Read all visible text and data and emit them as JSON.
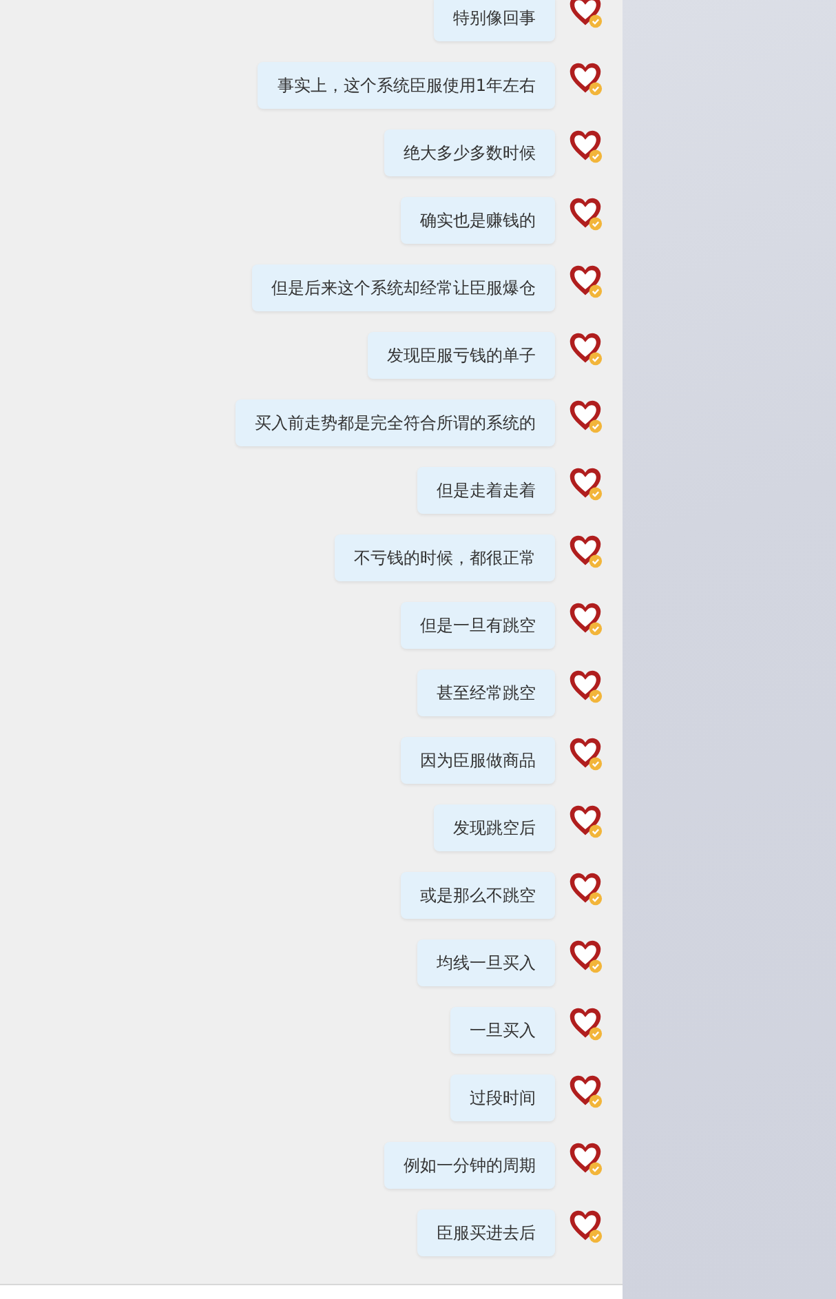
{
  "messages": [
    {
      "text": "特别像回事"
    },
    {
      "text": "事实上，这个系统臣服使用1年左右"
    },
    {
      "text": "绝大多少多数时候"
    },
    {
      "text": "确实也是赚钱的"
    },
    {
      "text": "但是后来这个系统却经常让臣服爆仓"
    },
    {
      "text": "发现臣服亏钱的单子"
    },
    {
      "text": "买入前走势都是完全符合所谓的系统的"
    },
    {
      "text": "但是走着走着"
    },
    {
      "text": "不亏钱的时候，都很正常"
    },
    {
      "text": "但是一旦有跳空"
    },
    {
      "text": "甚至经常跳空"
    },
    {
      "text": "因为臣服做商品"
    },
    {
      "text": "发现跳空后"
    },
    {
      "text": "或是那么不跳空"
    },
    {
      "text": "均线一旦买入"
    },
    {
      "text": "一旦买入"
    },
    {
      "text": "过段时间"
    },
    {
      "text": "例如一分钟的周期"
    },
    {
      "text": "臣服买进去后"
    }
  ]
}
